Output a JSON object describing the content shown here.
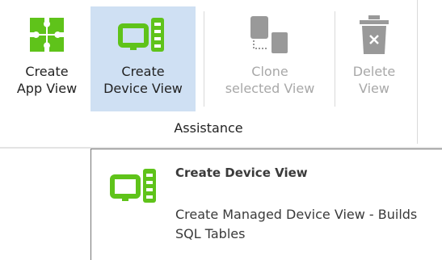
{
  "ribbon": {
    "buttons": [
      {
        "line1": "Create",
        "line2": "App View",
        "icon": "puzzle-icon"
      },
      {
        "line1": "Create",
        "line2": "Device View",
        "icon": "device-view-icon"
      },
      {
        "line1": "Clone",
        "line2": "selected View",
        "icon": "clone-view-icon"
      },
      {
        "line1": "Delete",
        "line2": "View",
        "icon": "trash-icon"
      }
    ],
    "group_label": "Assistance"
  },
  "tooltip": {
    "title": "Create Device View",
    "description": "Create Managed Device View - Builds SQL Tables"
  },
  "colors": {
    "accent_green": "#5fc31a",
    "hover_blue": "#cfe0f3",
    "disabled_gray": "#a8a8a8"
  }
}
